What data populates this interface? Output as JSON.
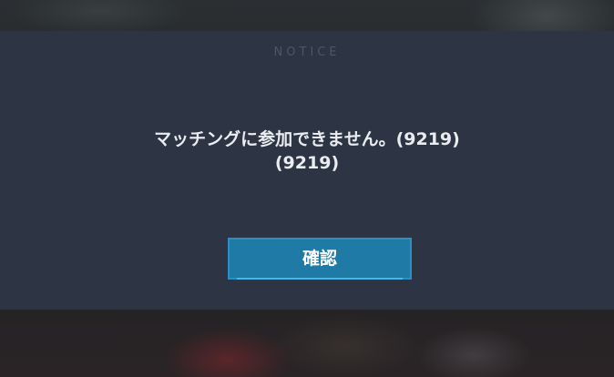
{
  "dialog": {
    "title": "NOTICE",
    "message_line1": "マッチングに参加できません。(9219)",
    "message_line2": "(9219)",
    "confirm_label": "確認"
  },
  "colors": {
    "panel": "#2d3443",
    "title": "#4d5566",
    "text": "#e9ecf0",
    "button": "#1f7aa6",
    "button_border": "#2d8fc4"
  }
}
